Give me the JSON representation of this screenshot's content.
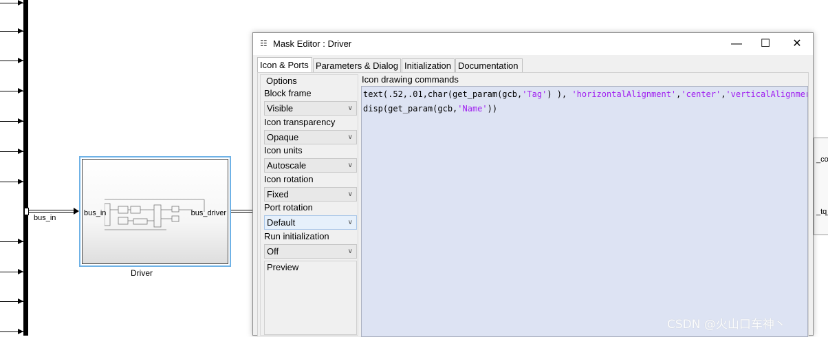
{
  "canvas": {
    "input_signal_label": "bus_in",
    "block": {
      "name": "Driver",
      "in_port_label": "bus_in",
      "out_port_label": "bus_driver"
    },
    "right_block_labels": [
      "_cor",
      "_tq_"
    ]
  },
  "window": {
    "title": "Mask Editor : Driver",
    "controls": {
      "minimize": "—",
      "maximize": "☐",
      "close": "✕"
    },
    "tabs": [
      {
        "label": "Icon & Ports",
        "active": true
      },
      {
        "label": "Parameters & Dialog",
        "active": false
      },
      {
        "label": "Initialization",
        "active": false
      },
      {
        "label": "Documentation",
        "active": false
      }
    ],
    "options": {
      "title": "Options",
      "fields": [
        {
          "label": "Block frame",
          "value": "Visible"
        },
        {
          "label": "Icon transparency",
          "value": "Opaque"
        },
        {
          "label": "Icon units",
          "value": "Autoscale"
        },
        {
          "label": "Icon rotation",
          "value": "Fixed"
        },
        {
          "label": "Port rotation",
          "value": "Default"
        },
        {
          "label": "Run initialization",
          "value": "Off"
        }
      ],
      "preview_label": "Preview"
    },
    "commands": {
      "title": "Icon drawing commands",
      "line1": {
        "a": "text(.52,.01,char(get_param(gcb,",
        "s1": "'Tag'",
        "b": ") ), ",
        "s2": "'horizontalAlignment'",
        "c": ",",
        "s3": "'center'",
        "d": ",",
        "s4": "'verticalAlignmer"
      },
      "line2": {
        "a": "disp(get_param(gcb,",
        "s1": "'Name'",
        "b": "))"
      }
    }
  },
  "watermark": "CSDN @火山口车神丶"
}
